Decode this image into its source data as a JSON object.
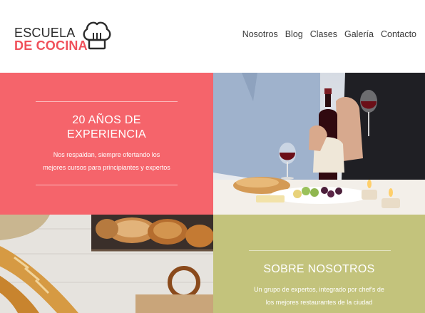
{
  "logo": {
    "line1": "ESCUELA",
    "line2": "DE COCINA",
    "icon": "chef-hat-icon"
  },
  "nav": {
    "items": [
      "Nosotros",
      "Blog",
      "Clases",
      "Galería",
      "Contacto"
    ]
  },
  "experience": {
    "title_line1": "20 AÑOS DE",
    "title_line2": "EXPERIENCIA",
    "text_line1": "Nos respaldan, siempre ofertando los",
    "text_line2": "mejores cursos para principiantes y expertos"
  },
  "about": {
    "title": "SOBRE NOSOTROS",
    "text_line1": "Un grupo de expertos, integrado por chef's de",
    "text_line2": "los mejores restaurantes de la ciudad"
  },
  "colors": {
    "accent": "#f0505a",
    "pink_tile": "#f5646b",
    "olive_tile": "#c3c37c",
    "text": "#3a3a3a"
  }
}
